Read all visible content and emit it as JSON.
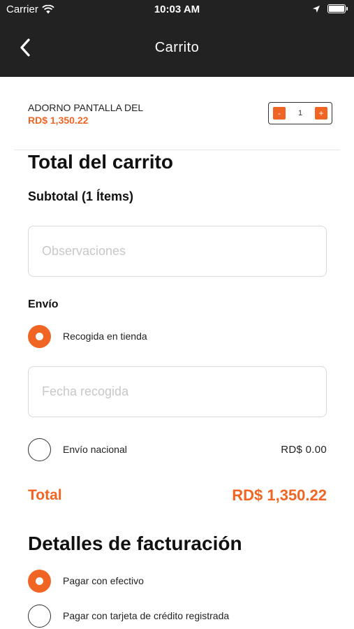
{
  "status_bar": {
    "carrier": "Carrier",
    "time": "10:03 AM"
  },
  "nav": {
    "title": "Carrito"
  },
  "cart_item": {
    "name": "ADORNO PANTALLA DEL",
    "price": "RD$ 1,350.22",
    "quantity": "1",
    "minus_label": "-",
    "plus_label": "+"
  },
  "cart_totals": {
    "heading": "Total del carrito",
    "subtotal_label": "Subtotal (1 Ítems)",
    "observations_placeholder": "Observaciones",
    "shipping_heading": "Envío",
    "pickup_label": "Recogida en tienda",
    "pickup_date_placeholder": "Fecha recogida",
    "national_label": "Envío nacional",
    "national_amount": "RD$ 0.00",
    "total_label": "Total",
    "total_value": "RD$ 1,350.22"
  },
  "billing": {
    "heading": "Detalles de facturación",
    "cash_label": "Pagar con efectivo",
    "card_label": "Pagar con tarjeta de crédito registrada"
  },
  "selections": {
    "shipping": "pickup",
    "payment": "cash"
  },
  "colors": {
    "accent": "#f06523",
    "header_bg": "#222222"
  }
}
